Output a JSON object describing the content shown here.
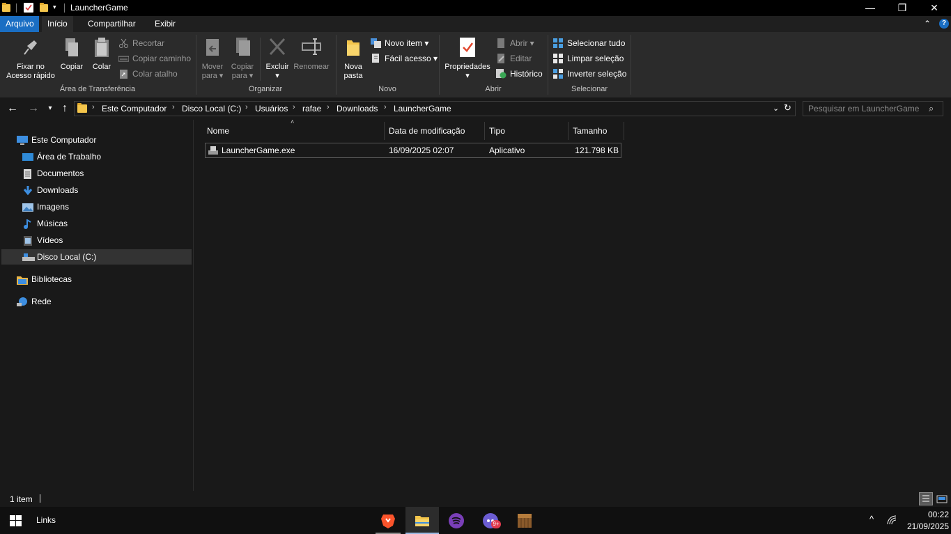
{
  "window": {
    "title": "LauncherGame",
    "controls": {
      "minimize": "—",
      "restore": "❐",
      "close": "✕"
    }
  },
  "ribbon_tabs": [
    "Arquivo",
    "Início",
    "Compartilhar",
    "Exibir"
  ],
  "ribbon": {
    "clipboard": {
      "pin": "Fixar no\nAcesso rápido",
      "copy": "Copiar",
      "paste": "Colar",
      "cut": "Recortar",
      "copy_path": "Copiar caminho",
      "paste_shortcut": "Colar atalho",
      "label": "Área de Transferência"
    },
    "organize": {
      "move_to": "Mover\npara ▾",
      "copy_to": "Copiar\npara ▾",
      "delete": "Excluir\n▾",
      "rename": "Renomear",
      "label": "Organizar"
    },
    "new": {
      "new_folder": "Nova\npasta",
      "new_item": "Novo item ▾",
      "easy_access": "Fácil acesso ▾",
      "label": "Novo"
    },
    "open": {
      "properties": "Propriedades\n▾",
      "open": "Abrir ▾",
      "edit": "Editar",
      "history": "Histórico",
      "label": "Abrir"
    },
    "select": {
      "select_all": "Selecionar tudo",
      "select_none": "Limpar seleção",
      "invert": "Inverter seleção",
      "label": "Selecionar"
    }
  },
  "breadcrumb": [
    "Este Computador",
    "Disco Local (C:)",
    "Usuários",
    "rafae",
    "Downloads",
    "LauncherGame"
  ],
  "search": {
    "placeholder": "Pesquisar em LauncherGame"
  },
  "sidebar": {
    "items": [
      {
        "label": "Este Computador",
        "icon": "computer-icon"
      },
      {
        "label": "Área de Trabalho",
        "icon": "desktop-icon"
      },
      {
        "label": "Documentos",
        "icon": "documents-icon"
      },
      {
        "label": "Downloads",
        "icon": "downloads-icon"
      },
      {
        "label": "Imagens",
        "icon": "pictures-icon"
      },
      {
        "label": "Músicas",
        "icon": "music-icon"
      },
      {
        "label": "Vídeos",
        "icon": "videos-icon"
      },
      {
        "label": "Disco Local (C:)",
        "icon": "drive-icon",
        "selected": true
      },
      {
        "label": "Bibliotecas",
        "icon": "libraries-icon"
      },
      {
        "label": "Rede",
        "icon": "network-icon"
      }
    ]
  },
  "file_list": {
    "columns": [
      "Nome",
      "Data de modificação",
      "Tipo",
      "Tamanho"
    ],
    "rows": [
      {
        "name": "LauncherGame.exe",
        "modified": "16/09/2025 02:07",
        "type": "Aplicativo",
        "size": "121.798 KB"
      }
    ]
  },
  "status": {
    "count": "1 item"
  },
  "taskbar": {
    "links": "Links",
    "time": "00:22",
    "date": "21/09/2025",
    "apps": [
      "brave-icon",
      "file-explorer-icon",
      "spotify-icon",
      "discord-icon",
      "minecraft-icon"
    ],
    "discord_badge": "9+"
  },
  "colors": {
    "accent": "#1a6ec3",
    "background": "#191919",
    "ribbon": "#2b2b2b"
  }
}
